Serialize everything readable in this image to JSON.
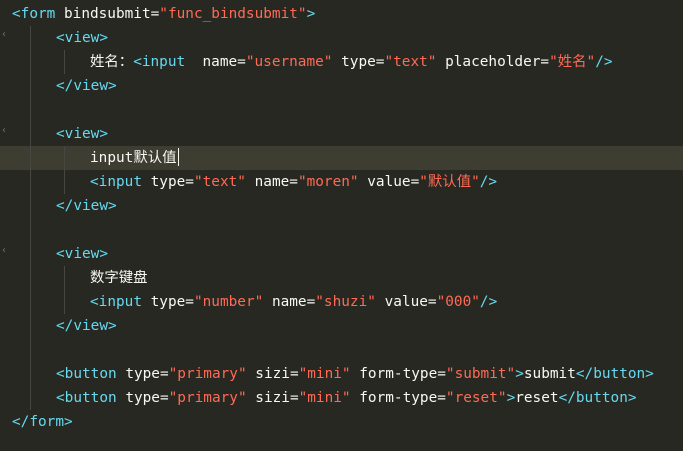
{
  "lines": [
    {
      "indent": 0,
      "fold": false,
      "tokens": [
        {
          "t": "<form",
          "c": "tag"
        },
        {
          "t": " bindsubmit=",
          "c": "attr"
        },
        {
          "t": "\"func_bindsubmit\"",
          "c": "str"
        },
        {
          "t": ">",
          "c": "tag"
        }
      ]
    },
    {
      "indent": 1,
      "fold": true,
      "tokens": [
        {
          "t": "<view>",
          "c": "tag"
        }
      ]
    },
    {
      "indent": 2,
      "fold": false,
      "tokens": [
        {
          "t": "姓名：",
          "c": "txt"
        },
        {
          "t": "<input",
          "c": "tag"
        },
        {
          "t": "  name=",
          "c": "attr"
        },
        {
          "t": "\"username\"",
          "c": "str"
        },
        {
          "t": " type=",
          "c": "attr"
        },
        {
          "t": "\"text\"",
          "c": "str"
        },
        {
          "t": " placeholder=",
          "c": "attr"
        },
        {
          "t": "\"姓名\"",
          "c": "str"
        },
        {
          "t": "/>",
          "c": "tag"
        }
      ]
    },
    {
      "indent": 1,
      "fold": false,
      "tokens": [
        {
          "t": "</view>",
          "c": "tag"
        }
      ]
    },
    {
      "indent": 1,
      "fold": false,
      "tokens": []
    },
    {
      "indent": 1,
      "fold": true,
      "tokens": [
        {
          "t": "<view>",
          "c": "tag"
        }
      ]
    },
    {
      "indent": 2,
      "fold": false,
      "current": true,
      "caret": true,
      "tokens": [
        {
          "t": "input默认值",
          "c": "txt"
        }
      ]
    },
    {
      "indent": 2,
      "fold": false,
      "tokens": [
        {
          "t": "<input",
          "c": "tag"
        },
        {
          "t": " type=",
          "c": "attr"
        },
        {
          "t": "\"text\"",
          "c": "str"
        },
        {
          "t": " name=",
          "c": "attr"
        },
        {
          "t": "\"moren\"",
          "c": "str"
        },
        {
          "t": " value=",
          "c": "attr"
        },
        {
          "t": "\"默认值\"",
          "c": "str"
        },
        {
          "t": "/>",
          "c": "tag"
        }
      ]
    },
    {
      "indent": 1,
      "fold": false,
      "tokens": [
        {
          "t": "</view>",
          "c": "tag"
        }
      ]
    },
    {
      "indent": 1,
      "fold": false,
      "tokens": []
    },
    {
      "indent": 1,
      "fold": true,
      "tokens": [
        {
          "t": "<view>",
          "c": "tag"
        }
      ]
    },
    {
      "indent": 2,
      "fold": false,
      "tokens": [
        {
          "t": "数字键盘",
          "c": "txt"
        }
      ]
    },
    {
      "indent": 2,
      "fold": false,
      "tokens": [
        {
          "t": "<input",
          "c": "tag"
        },
        {
          "t": " type=",
          "c": "attr"
        },
        {
          "t": "\"number\"",
          "c": "str"
        },
        {
          "t": " name=",
          "c": "attr"
        },
        {
          "t": "\"shuzi\"",
          "c": "str"
        },
        {
          "t": " value=",
          "c": "attr"
        },
        {
          "t": "\"000\"",
          "c": "str"
        },
        {
          "t": "/>",
          "c": "tag"
        }
      ]
    },
    {
      "indent": 1,
      "fold": false,
      "tokens": [
        {
          "t": "</view>",
          "c": "tag"
        }
      ]
    },
    {
      "indent": 1,
      "fold": false,
      "tokens": []
    },
    {
      "indent": 1,
      "fold": false,
      "tokens": [
        {
          "t": "<button",
          "c": "tag"
        },
        {
          "t": " type=",
          "c": "attr"
        },
        {
          "t": "\"primary\"",
          "c": "str"
        },
        {
          "t": " sizi=",
          "c": "attr"
        },
        {
          "t": "\"mini\"",
          "c": "str"
        },
        {
          "t": " form-type=",
          "c": "attr"
        },
        {
          "t": "\"submit\"",
          "c": "str"
        },
        {
          "t": ">",
          "c": "tag"
        },
        {
          "t": "submit",
          "c": "txt"
        },
        {
          "t": "</button>",
          "c": "tag"
        }
      ]
    },
    {
      "indent": 1,
      "fold": false,
      "tokens": [
        {
          "t": "<button",
          "c": "tag"
        },
        {
          "t": " type=",
          "c": "attr"
        },
        {
          "t": "\"primary\"",
          "c": "str"
        },
        {
          "t": " sizi=",
          "c": "attr"
        },
        {
          "t": "\"mini\"",
          "c": "str"
        },
        {
          "t": " form-type=",
          "c": "attr"
        },
        {
          "t": "\"reset\"",
          "c": "str"
        },
        {
          "t": ">",
          "c": "tag"
        },
        {
          "t": "reset",
          "c": "txt"
        },
        {
          "t": "</button>",
          "c": "tag"
        }
      ]
    },
    {
      "indent": 0,
      "fold": false,
      "tokens": [
        {
          "t": "</form>",
          "c": "tag"
        }
      ]
    }
  ]
}
